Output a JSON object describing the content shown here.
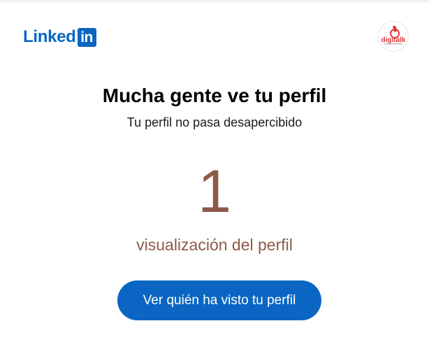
{
  "header": {
    "brand_text": "Linked",
    "brand_box_text": "in",
    "avatar_text": "digitalk"
  },
  "main": {
    "title": "Mucha gente ve tu perfil",
    "subtitle": "Tu perfil no pasa desapercibido",
    "views_count": "1",
    "views_label": "visualización del perfil",
    "cta_label": "Ver quién ha visto tu perfil"
  },
  "colors": {
    "brand_blue": "#0a66c2",
    "accent_brown": "#8c5a48",
    "avatar_red": "#e03a3a"
  }
}
